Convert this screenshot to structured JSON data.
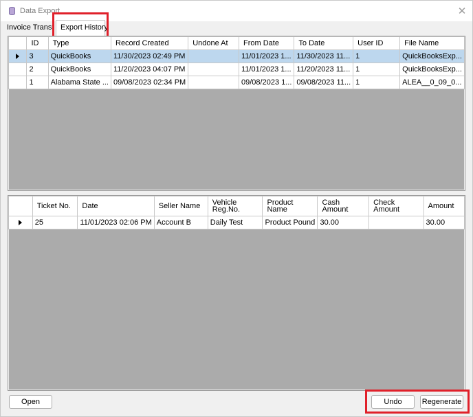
{
  "window": {
    "title": "Data Export",
    "close_glyph": "✕"
  },
  "tabs": {
    "invoice": "Invoice Transfer",
    "history": "Export History"
  },
  "exports": {
    "columns": [
      "ID",
      "Type",
      "Record Created",
      "Undone At",
      "From Date",
      "To Date",
      "User ID",
      "File Name"
    ],
    "rows": [
      [
        "3",
        "QuickBooks",
        "11/30/2023  02:49 PM",
        "",
        "11/01/2023  1...",
        "11/30/2023  11...",
        "1",
        "QuickBooksExp..."
      ],
      [
        "2",
        "QuickBooks",
        "11/20/2023  04:07 PM",
        "",
        "11/01/2023  1...",
        "11/20/2023  11...",
        "1",
        "QuickBooksExp..."
      ],
      [
        "1",
        "Alabama State ...",
        "09/08/2023  02:34 PM",
        "",
        "09/08/2023  1...",
        "09/08/2023  11...",
        "1",
        "ALEA__0_09_0..."
      ]
    ]
  },
  "tickets": {
    "columns": [
      "Ticket No.",
      "Date",
      "Seller Name",
      "Vehicle Reg.No.",
      "Product Name",
      "Cash Amount",
      "Check Amount",
      "Amount"
    ],
    "rows": [
      [
        "25",
        "11/01/2023  02:06 PM",
        "Account B",
        "Daily Test",
        "Product Pound",
        "30.00",
        "",
        "30.00"
      ]
    ]
  },
  "buttons": {
    "open": "Open",
    "undo": "Undo",
    "regenerate": "Regenerate"
  },
  "colors": {
    "highlight": "#e0202a",
    "selected_row": "#bdd7ee",
    "empty_grid": "#ababab"
  },
  "icons": {
    "title": "database-icon",
    "row_pointer": "row-pointer-icon",
    "close": "close-icon"
  }
}
